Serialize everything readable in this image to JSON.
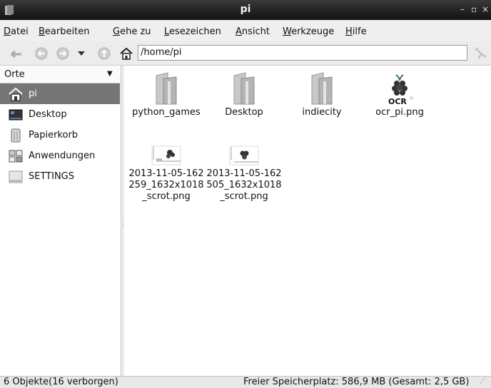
{
  "window": {
    "title": "pi",
    "controls": [
      "–",
      "▫",
      "×"
    ]
  },
  "menu": [
    "Datei",
    "Bearbeiten",
    "Gehe zu",
    "Lesezeichen",
    "Ansicht",
    "Werkzeuge",
    "Hilfe"
  ],
  "toolbar": {
    "path": "/home/pi",
    "icons": [
      "back-icon",
      "forward-icon",
      "history-dropdown-icon",
      "up-icon",
      "home-icon",
      "go-icon"
    ]
  },
  "sidebar": {
    "header": "Orte",
    "places": [
      {
        "label": "pi",
        "icon": "home-icon",
        "selected": true
      },
      {
        "label": "Desktop",
        "icon": "desktop-icon",
        "selected": false
      },
      {
        "label": "Papierkorb",
        "icon": "trash-icon",
        "selected": false
      },
      {
        "label": "Anwendungen",
        "icon": "applications-icon",
        "selected": false
      },
      {
        "label": "SETTINGS",
        "icon": "drive-icon",
        "selected": false
      }
    ]
  },
  "files": [
    {
      "name": "python_games",
      "type": "folder"
    },
    {
      "name": "Desktop",
      "type": "folder"
    },
    {
      "name": "indiecity",
      "type": "folder"
    },
    {
      "name": "ocr_pi.png",
      "type": "image-ocr"
    },
    {
      "name": "2013-11-05-162259_1632x1018_scrot.png",
      "type": "image-screenshot"
    },
    {
      "name": "2013-11-05-162505_1632x1018_scrot.png",
      "type": "image-screenshot"
    }
  ],
  "status": {
    "items": "6 Objekte(16 verborgen)",
    "free_space": "Freier Speicherplatz: 586,9 MB (Gesamt: 2,5 GB)"
  },
  "ocr_logo_text": "OCR",
  "colors": {
    "selection": "#757575",
    "titlebar": "#1a1a1a",
    "raspberry": "#c51a4a"
  }
}
